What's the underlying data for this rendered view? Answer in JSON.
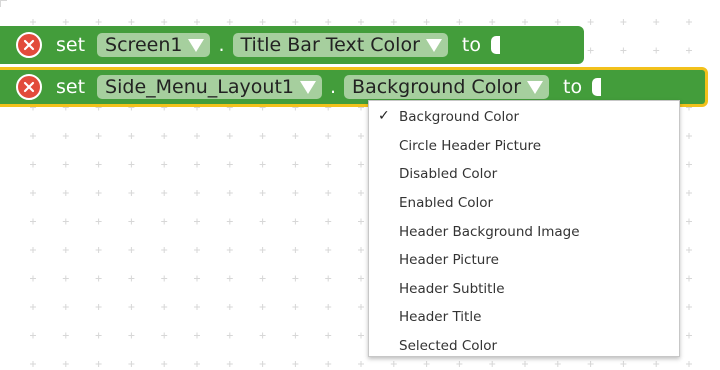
{
  "blocks": [
    {
      "keyword": "set",
      "component": "Screen1",
      "dot": ".",
      "property": "Title Bar Text Color",
      "to_label": "to"
    },
    {
      "keyword": "set",
      "component": "Side_Menu_Layout1",
      "dot": ".",
      "property": "Background Color",
      "to_label": "to"
    }
  ],
  "dropdown": {
    "selected": "Background Color",
    "check_mark": "✓",
    "items": [
      "Background Color",
      "Circle Header Picture",
      "Disabled Color",
      "Enabled Color",
      "Header Background Image",
      "Header Picture",
      "Header Subtitle",
      "Header Title",
      "Selected Color"
    ]
  },
  "colors": {
    "block_green": "#439d3b",
    "chip_green": "#a6cf9e",
    "selection_yellow": "#f2c11b",
    "delete_red": "#e24b3b",
    "grid_plus": "#d7d7d7"
  },
  "icons": {
    "delete": "close-x-circle-icon",
    "dropdown": "chevron-down-icon",
    "grid": "plus-icon"
  }
}
